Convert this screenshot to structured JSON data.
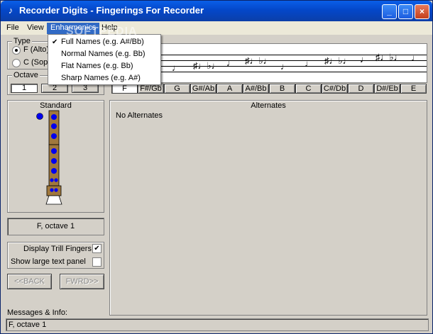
{
  "window": {
    "title": "Recorder Digits - Fingerings For Recorder",
    "min_glyph": "_",
    "max_glyph": "□",
    "close_glyph": "×"
  },
  "menu": {
    "items": [
      "File",
      "View",
      "Enharmonics",
      "Help"
    ],
    "active": "Enharmonics",
    "dropdown": [
      {
        "label": "Full Names (e.g. A#/Bb)",
        "checked": true
      },
      {
        "label": "Normal Names (e.g. Bb)",
        "checked": false
      },
      {
        "label": "Flat Names (e.g. Bb)",
        "checked": false
      },
      {
        "label": "Sharp Names (e.g. A#)",
        "checked": false
      }
    ],
    "check_glyph": "✔"
  },
  "type_group": {
    "label": "Type",
    "options": [
      {
        "label": "F (Alto)",
        "checked": true
      },
      {
        "label": "C (Sop",
        "checked": false
      }
    ]
  },
  "octave_group": {
    "label": "Octave",
    "buttons": [
      "1",
      "2",
      "3"
    ],
    "selected": "1"
  },
  "notes": {
    "buttons": [
      "F",
      "F#/Gb",
      "G",
      "G#/Ab",
      "A",
      "A#/Bb",
      "B",
      "C",
      "C#/Db",
      "D",
      "D#/Eb",
      "E"
    ],
    "selected": "F"
  },
  "standard": {
    "title": "Standard",
    "holes": [
      "closed",
      "closed",
      "closed",
      "closed",
      "closed",
      "closed",
      "closed",
      "closed-half"
    ],
    "thumb": "closed"
  },
  "alternates": {
    "title": "Alternates",
    "message": "No Alternates"
  },
  "current_note": "F, octave 1",
  "options": {
    "trill_label": "Display Trill Fingers",
    "trill_checked": true,
    "large_label": "Show large text panel",
    "large_checked": false
  },
  "nav": {
    "back_label": "<<BACK",
    "fwrd_label": "FWRD>>"
  },
  "messages": {
    "label": "Messages & Info:",
    "status": "F, octave 1"
  },
  "watermark": "SOFTPEDIA"
}
